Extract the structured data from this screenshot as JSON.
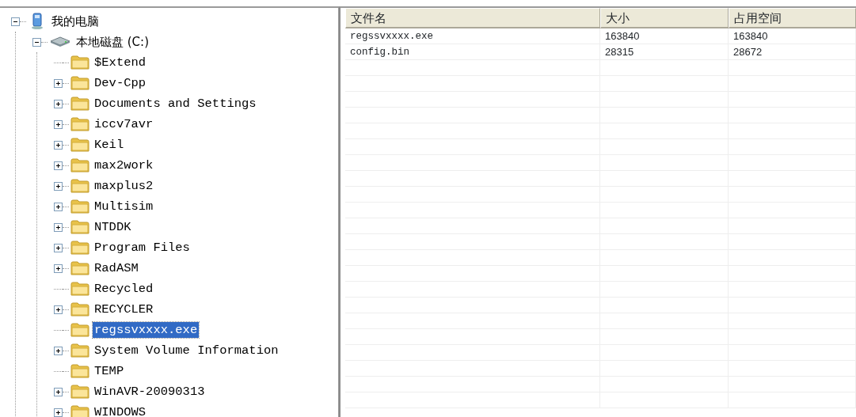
{
  "tree": [
    {
      "label": "我的电脑",
      "kind": "computer",
      "selected": false,
      "expanded": true,
      "children": [
        {
          "label": "本地磁盘 (C:)",
          "kind": "drive",
          "selected": false,
          "expanded": true,
          "children": [
            {
              "label": "$Extend",
              "kind": "folder",
              "selected": false
            },
            {
              "label": "Dev-Cpp",
              "kind": "folder",
              "selected": false,
              "expanded": false
            },
            {
              "label": "Documents and Settings",
              "kind": "folder",
              "selected": false,
              "expanded": false
            },
            {
              "label": "iccv7avr",
              "kind": "folder",
              "selected": false,
              "expanded": false
            },
            {
              "label": "Keil",
              "kind": "folder",
              "selected": false,
              "expanded": false
            },
            {
              "label": "max2work",
              "kind": "folder",
              "selected": false,
              "expanded": false
            },
            {
              "label": "maxplus2",
              "kind": "folder",
              "selected": false,
              "expanded": false
            },
            {
              "label": "Multisim",
              "kind": "folder",
              "selected": false,
              "expanded": false
            },
            {
              "label": "NTDDK",
              "kind": "folder",
              "selected": false,
              "expanded": false
            },
            {
              "label": "Program Files",
              "kind": "folder",
              "selected": false,
              "expanded": false
            },
            {
              "label": "RadASM",
              "kind": "folder",
              "selected": false,
              "expanded": false
            },
            {
              "label": "Recycled",
              "kind": "folder",
              "selected": false
            },
            {
              "label": "RECYCLER",
              "kind": "folder",
              "selected": false,
              "expanded": false
            },
            {
              "label": "regssvxxxx.exe",
              "kind": "folder",
              "selected": true
            },
            {
              "label": "System Volume Information",
              "kind": "folder",
              "selected": false,
              "expanded": false
            },
            {
              "label": "TEMP",
              "kind": "folder",
              "selected": false
            },
            {
              "label": "WinAVR-20090313",
              "kind": "folder",
              "selected": false,
              "expanded": false
            },
            {
              "label": "WINDOWS",
              "kind": "folder",
              "selected": false,
              "expanded": false
            }
          ]
        }
      ]
    }
  ],
  "table": {
    "columns": [
      "文件名",
      "大小",
      "占用空间"
    ],
    "rows": [
      [
        "regssvxxxx.exe",
        "163840",
        "163840"
      ],
      [
        "config.bin",
        "28315",
        "28672"
      ]
    ]
  }
}
